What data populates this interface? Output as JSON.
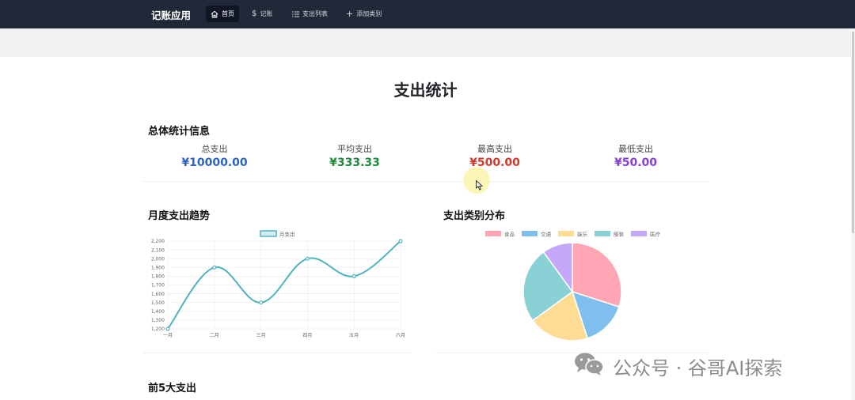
{
  "navbar": {
    "brand": "记账应用",
    "items": [
      {
        "label": "首页",
        "icon": "home-icon",
        "active": true
      },
      {
        "label": "记账",
        "icon": "dollar-icon",
        "active": false
      },
      {
        "label": "支出列表",
        "icon": "list-icon",
        "active": false
      },
      {
        "label": "添加类别",
        "icon": "plus-icon",
        "active": false
      }
    ]
  },
  "page": {
    "title": "支出统计"
  },
  "overview": {
    "title": "总体统计信息",
    "stats": [
      {
        "label": "总支出",
        "value": "¥10000.00",
        "color": "#2b63c4"
      },
      {
        "label": "平均支出",
        "value": "¥333.33",
        "color": "#1e8a3e"
      },
      {
        "label": "最高支出",
        "value": "¥500.00",
        "color": "#d0392b"
      },
      {
        "label": "最低支出",
        "value": "¥50.00",
        "color": "#8a3fd1"
      }
    ]
  },
  "trend": {
    "title": "月度支出趋势"
  },
  "distribution": {
    "title": "支出类别分布"
  },
  "top5": {
    "title": "前5大支出"
  },
  "watermark": {
    "text": "公众号 · 谷哥AI探索"
  },
  "chart_data": [
    {
      "type": "line",
      "categories": [
        "一月",
        "二月",
        "三月",
        "四月",
        "五月",
        "六月"
      ],
      "series": [
        {
          "name": "月支出",
          "values": [
            1200,
            1900,
            1500,
            2000,
            1800,
            2200
          ],
          "color": "#4fb3bf"
        }
      ],
      "y_ticks": [
        "1,200",
        "1,300",
        "1,400",
        "1,500",
        "1,600",
        "1,700",
        "1,800",
        "1,900",
        "2,000",
        "2,100",
        "2,200"
      ],
      "ylim": [
        1200,
        2200
      ],
      "grid": true,
      "legend": "top-center"
    },
    {
      "type": "pie",
      "labels": [
        "食品",
        "交通",
        "娱乐",
        "服装",
        "医疗"
      ],
      "values": [
        30,
        15,
        20,
        25,
        10
      ],
      "colors": [
        "#ffa5b4",
        "#7fbfee",
        "#ffdc94",
        "#89d1d5",
        "#c6a8fb"
      ],
      "legend": "top"
    }
  ]
}
